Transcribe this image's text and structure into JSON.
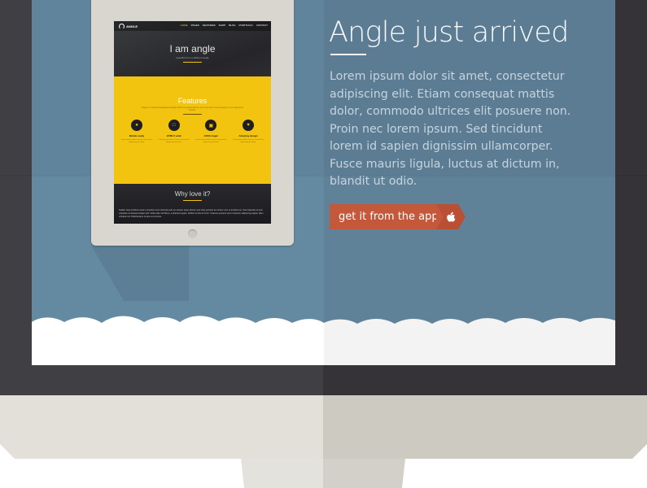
{
  "monitor": {
    "bezel_color": "#353338",
    "screen_color": "#648aa2",
    "stand_color": "#e2e0d9"
  },
  "tablet": {
    "site": {
      "logo": "ANGLE",
      "nav": [
        "HOME",
        "PAGES",
        "FEATURES",
        "SHOP",
        "BLOG",
        "PORTFOLIO",
        "CONTACT"
      ],
      "hero_title": "I am angle",
      "hero_sub": "beautiful from a different angle",
      "features_title": "Features",
      "features_sub": "Angle is a minimal designed template which is a great start for your new site. It's just ready for your awesome content.",
      "features": [
        {
          "icon": "mobile-icon",
          "label": "Mobile ready",
          "text": "Lorem ipsum dolor sit amet consectetur adipiscing elit etiam."
        },
        {
          "icon": "html5-icon",
          "label": "HTML5 valid",
          "text": "Lorem ipsum dolor sit amet consectetur adipiscing elit etiam."
        },
        {
          "icon": "css3-icon",
          "label": "CSS3 magic",
          "text": "Lorem ipsum dolor sit amet consectetur adipiscing elit etiam."
        },
        {
          "icon": "heart-icon",
          "label": "Amazing design",
          "text": "Lorem ipsum dolor sit amet consectetur adipiscing elit etiam."
        }
      ],
      "why_title": "Why love it?",
      "why_text": "Nullam vitae tincidunt quam a tincidunt eros vehicula velit, ac semper quam dictum sed. Duis pulvinar ac ornare nunc ut tincidunt eu. Sed vulputate at erat vulputate consequat feugiat velit. Nulla vitae nisl libero, a pharetra augue. Nullam id ante id tortor. Vivamus posuere erat a interdum adipiscing sapien diam volutpat nisl. Pellentesque ornare est a lectus."
    },
    "accent": "#f2c30f"
  },
  "hero": {
    "headline": "Angle just arrived",
    "body": "Lorem ipsum dolor sit amet, consectetur adipiscing elit. Etiam consequat mattis dolor, commodo ultrices elit posuere non. Proin nec lorem ipsum. Sed tincidunt lorem id sapien dignissim ullamcorper. Fusce mauris ligula, luctus at dictum in, blandit ut odio.",
    "button_label": "get it from the appstore",
    "button_icon": "apple-icon",
    "button_color": "#c3583b"
  }
}
